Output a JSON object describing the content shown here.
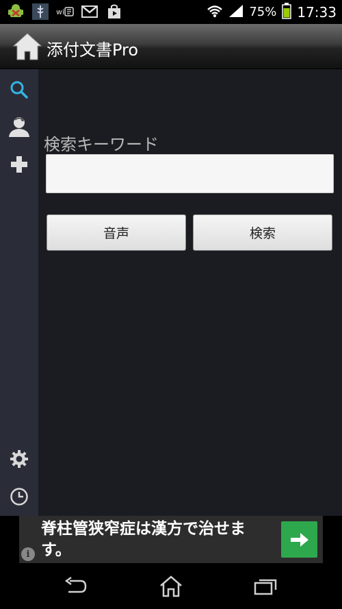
{
  "status_bar": {
    "battery": "75%",
    "time": "17:33",
    "notification_icons": [
      "android-debug-icon",
      "app-notification-icon",
      "wifi-direct-icon",
      "gmail-icon",
      "play-store-icon"
    ],
    "wifi_chip_label": "wi"
  },
  "action_bar": {
    "title": "添付文書Pro",
    "home_icon": "home-icon"
  },
  "side_rail": {
    "items": [
      {
        "icon": "search-icon"
      },
      {
        "icon": "doctor-icon"
      },
      {
        "icon": "plus-icon"
      },
      {
        "icon": "gear-icon"
      },
      {
        "icon": "clock-icon"
      }
    ],
    "accent_color": "#33b5e5"
  },
  "search_form": {
    "label": "検索キーワード",
    "input_value": "",
    "voice_button": "音声",
    "search_button": "検索"
  },
  "ad": {
    "text": "脊柱管狭窄症は漢方で治せます。",
    "info_symbol": "i",
    "arrow_color": "#2ea84d"
  },
  "nav_bar": {
    "buttons": [
      "back-icon",
      "home-icon",
      "recent-apps-icon"
    ]
  }
}
